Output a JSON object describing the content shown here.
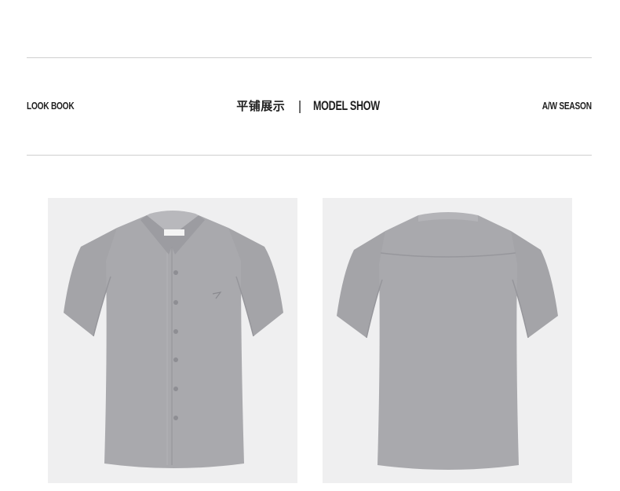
{
  "header": {
    "left_label": "LOOK BOOK",
    "title_cn": "平铺展示",
    "separator": "|",
    "title_en": "MODEL SHOW",
    "right_label": "A/W SEASON"
  },
  "gallery": {
    "items": [
      {
        "view": "front",
        "subject": "short-sleeve shirt"
      },
      {
        "view": "back",
        "subject": "short-sleeve shirt"
      }
    ],
    "colors": {
      "photo_background": "#efeff0",
      "shirt": "#a6a6aa",
      "shirt_shadow": "#8f8f94",
      "divider": "#cfcfcf"
    }
  }
}
